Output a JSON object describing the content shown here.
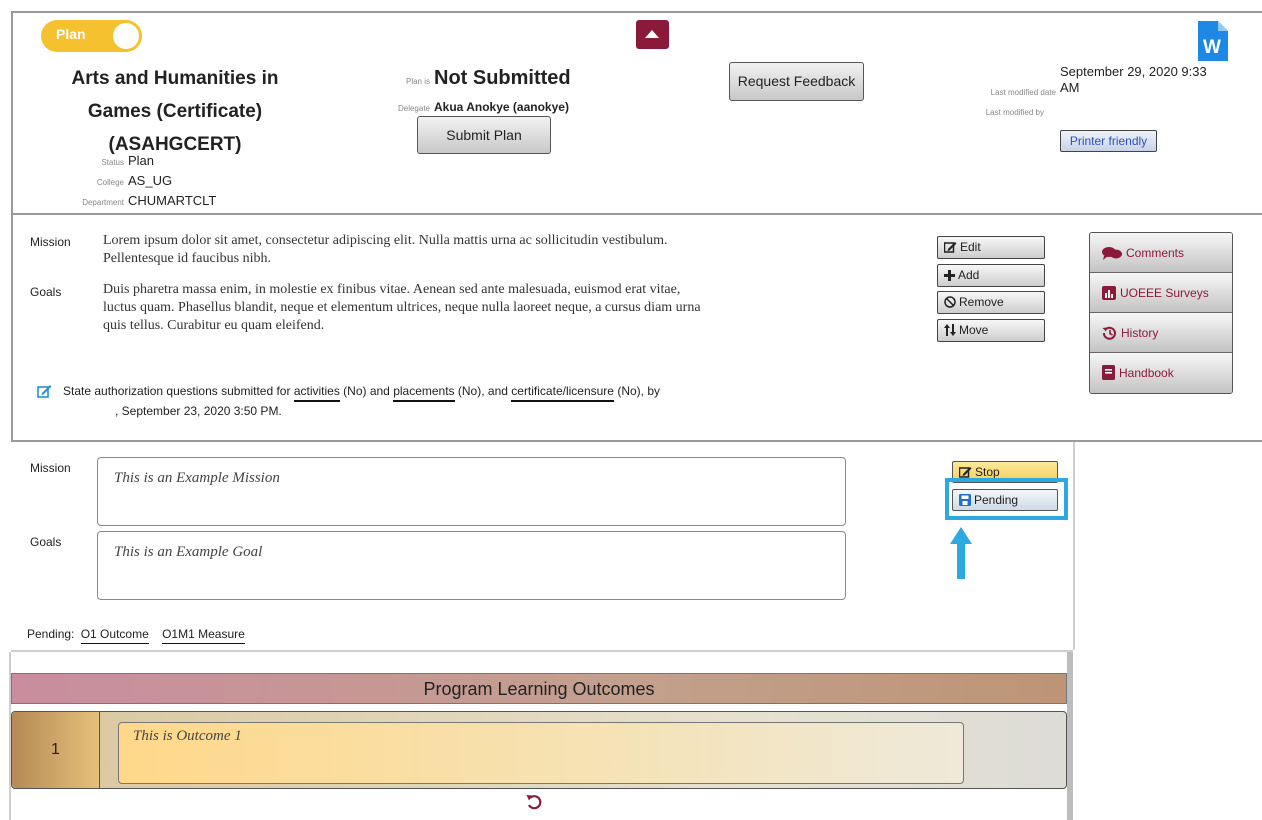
{
  "header": {
    "plan_toggle_label": "Plan",
    "program_title_lines": [
      "Arts and Humanities in",
      "Games (Certificate)",
      "(ASAHGCERT)"
    ],
    "status_label": "Status",
    "status_value": "Plan",
    "college_label": "College",
    "college_value": "AS_UG",
    "department_label": "Department",
    "department_value": "CHUMARTCLT",
    "plan_is_label": "Plan is",
    "plan_is_value": "Not Submitted",
    "delegate_label": "Delegate",
    "delegate_value": "Akua Anokye (aanokye)",
    "submit_button": "Submit Plan",
    "request_feedback_button": "Request Feedback",
    "last_modified_date_label": "Last modified date",
    "last_modified_date_line1": "September 29, 2020 9:33",
    "last_modified_date_line2": "AM",
    "last_modified_by_label": "Last modified by",
    "printer_friendly": "Printer friendly",
    "word_icon_letter": "W"
  },
  "summary": {
    "mission_label": "Mission",
    "mission_text_lines": [
      "Lorem ipsum dolor sit amet, consectetur adipiscing elit. Nulla mattis urna ac sollicitudin vestibulum.",
      "Pellentesque id faucibus nibh."
    ],
    "goals_label": "Goals",
    "goals_text_lines": [
      "Duis pharetra massa enim, in molestie ex finibus vitae. Aenean sed ante malesuada, euismod erat vitae,",
      "luctus quam.  Phasellus blandit, neque et elementum ultrices, neque nulla laoreet neque, a cursus diam urna",
      "quis tellus. Curabitur eu quam  eleifend."
    ],
    "state_auth": {
      "part1": "State authorization questions submitted for ",
      "activities": "activities",
      "part2": " (No) and ",
      "placements": "placements",
      "part3": " (No), and ",
      "certificate": "certificate/licensure",
      "part4": " (No), by",
      "line2": ", September 23, 2020 3:50 PM."
    }
  },
  "actions": {
    "edit": "Edit",
    "add": "Add",
    "remove": "Remove",
    "move": "Move"
  },
  "side_panel": {
    "comments": "Comments",
    "surveys": "UOEEE Surveys",
    "history": "History",
    "handbook": "Handbook"
  },
  "editor": {
    "mission_label": "Mission",
    "mission_value": "This is an Example Mission",
    "goals_label": "Goals",
    "goals_value": "This is an Example Goal",
    "stop_button": "Stop",
    "pending_button": "Pending",
    "pending_label": "Pending:",
    "pending_links": [
      "O1 Outcome",
      "O1M1 Measure"
    ]
  },
  "outcomes": {
    "section_title": "Program Learning Outcomes",
    "items": [
      {
        "number": "1",
        "text": "This is Outcome 1"
      }
    ]
  },
  "colors": {
    "toggle": "#f6c12f",
    "maroon": "#8b1a3a",
    "highlight": "#2ba9e0",
    "link_blue": "#2a52be"
  }
}
